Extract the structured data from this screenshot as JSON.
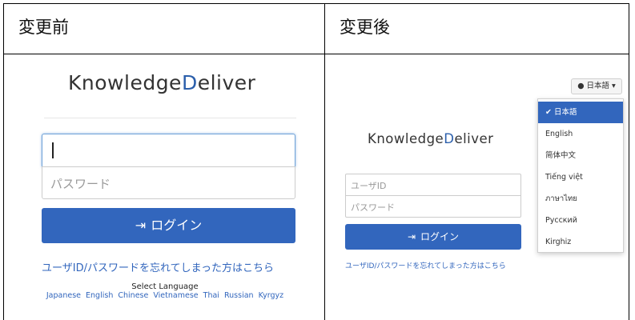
{
  "table": {
    "before_header": "変更前",
    "after_header": "変更後"
  },
  "before": {
    "logo_k": "K",
    "logo_mid": "nowledge",
    "logo_d": "D",
    "logo_end": "eliver",
    "password_placeholder": "パスワード",
    "login_icon": "⇥",
    "login_label": "ログイン",
    "forgot_link": "ユーザID/パスワードを忘れてしまった方はこちら",
    "select_language": "Select Language",
    "languages": [
      "Japanese",
      "English",
      "Chinese",
      "Vietnamese",
      "Thai",
      "Russian",
      "Kyrgyz"
    ]
  },
  "after": {
    "logo_k": "K",
    "logo_mid": "nowledge",
    "logo_d": "D",
    "logo_end": "eliver",
    "userid_placeholder": "ユーザID",
    "password_placeholder": "パスワード",
    "login_icon": "⇥",
    "login_label": "ログイン",
    "forgot_link": "ユーザID/パスワードを忘れてしまった方はこちら",
    "lang_toggle": "● 日本語 ▾",
    "dropdown_items": [
      "✔ 日本語",
      "English",
      "简体中文",
      "Tiếng việt",
      "ภาษาไทย",
      "Русский",
      "Kirghiz"
    ]
  },
  "colors": {
    "accent": "#3266bd",
    "logo_accent": "#2b5fab"
  }
}
